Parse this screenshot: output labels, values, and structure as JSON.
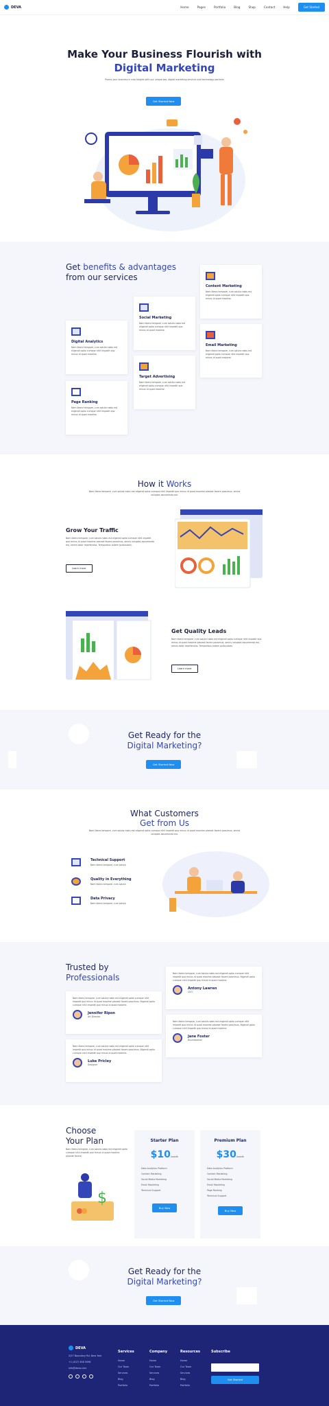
{
  "nav": {
    "brand": "DEVA",
    "items": [
      "Home",
      "Pages",
      "Portfolio",
      "Blog",
      "Shop",
      "Contact",
      "Help"
    ],
    "cta": "Get Started"
  },
  "hero": {
    "title1": "Make Your Business Flourish with",
    "title2": "Digital Marketing",
    "sub": "Promo your business in new heights with our unique seo, digital marketing services and technology partners",
    "cta": "Get Started Now"
  },
  "benefits": {
    "title1": "Get",
    "title_accent": "benefits & advantages",
    "title2": "from our services",
    "cards": [
      {
        "title": "Content Marketing",
        "text": "Nam libero tempore, cum soluta nobis est eligendi optio cumque nihil impedit quo minus id quod maxime."
      },
      {
        "title": "Social Marketing",
        "text": "Nam libero tempore, cum soluta nobis est eligendi optio cumque nihil impedit quo minus id quod maxime."
      },
      {
        "title": "Email Marketing",
        "text": "Nam libero tempore, cum soluta nobis est eligendi optio cumque nihil impedit quo minus id quod maxime."
      },
      {
        "title": "Digital Analytics",
        "text": "Nam libero tempore, cum soluta nobis est eligendi optio cumque nihil impedit quo minus id quod maxime."
      },
      {
        "title": "Target Advertising",
        "text": "Nam libero tempore, cum soluta nobis est eligendi optio cumque nihil impedit quo minus id quod maxime."
      },
      {
        "title": "Page Ranking",
        "text": "Nam libero tempore, cum soluta nobis est eligendi optio cumque nihil impedit quo minus id quod maxime."
      }
    ]
  },
  "how": {
    "title1": "How it",
    "title_accent": "Works",
    "sub": "Nam libero tempore, cum soluta nobis est eligendi optio cumque nihil impedit quo minus id quod maxime placeat facere possimus, omnis voluptas assumenda est.",
    "f1": {
      "title": "Grow Your Traffic",
      "text": "Nam libero tempore, cum soluta nobis est eligendi optio cumque nihil impedit quo minus id quod maxime placeat facere possimus, omnis voluptas assumenda est, omnis dolor repellendus. Temporibus autem quibusdam.",
      "btn": "Learn more"
    },
    "f2": {
      "title": "Get Quality Leads",
      "text": "Nam libero tempore, cum soluta nobis est eligendi optio cumque nihil impedit quo minus id quod maxime placeat facere possimus, omnis voluptas assumenda est, omnis dolor repellendus. Temporibus autem quibusdam.",
      "btn": "Learn more"
    }
  },
  "ready": {
    "line1": "Get Ready for the",
    "line2": "Digital Marketing?",
    "cta": "Get Started Now"
  },
  "customers": {
    "title1": "What Customers",
    "title2": "Get from Us",
    "sub": "Nam libero tempore, cum soluta nobis est eligendi optio cumque nihil impedit quo minus id quod maxime placeat facere possimus, omnis voluptas assumenda est.",
    "items": [
      {
        "title": "Technical Support",
        "text": "Nam libero tempore, cum soluta"
      },
      {
        "title": "Quality in Everything",
        "text": "Nam libero tempore, cum soluta"
      },
      {
        "title": "Data Privacy",
        "text": "Nam libero tempore, cum soluta"
      }
    ]
  },
  "trusted": {
    "title1": "Trusted by",
    "title2": "Professionals",
    "testimonials": [
      {
        "text": "Nam libero tempore, cum soluta nobis est eligendi optio cumque nihil impedit quo minus id quod maxime placeat facere possimus. Nigendi optio cumque nihil impedit quo minus id quod maxime.",
        "name": "Antony Lawren",
        "role": "CEO"
      },
      {
        "text": "Nam libero tempore, cum soluta nobis est eligendi optio cumque nihil impedit quo minus id quod maxime placeat facere possimus. Nigendi optio cumque nihil impedit quo minus id quod maxime.",
        "name": "Jennifer Ripon",
        "role": "Art Director"
      },
      {
        "text": "Nam libero tempore, cum soluta nobis est eligendi optio cumque nihil impedit quo minus id quod maxime placeat facere possimus. Nigendi optio cumque nihil impedit quo minus id quod maxime.",
        "name": "Jane Foster",
        "role": "Businessman"
      },
      {
        "text": "Nam libero tempore, cum soluta nobis est eligendi optio cumque nihil impedit quo minus id quod maxime placeat facere possimus. Nigendi optio cumque nihil impedit quo minus id quod maxime.",
        "name": "Luke Pricley",
        "role": "Designer"
      }
    ]
  },
  "plans": {
    "title1": "Choose",
    "title2": "Your Plan",
    "text": "Nam libero tempore, cum soluta nobis est eligendi optio cumque nihil impedit quo minus id quod maxime placeat facere.",
    "starter": {
      "name": "Starter Plan",
      "price": "$10",
      "unit": "/month",
      "features": [
        "Data Analytics Platform",
        "Content Marketing",
        "Social Media Marketing",
        "Email Marketing",
        "Technical Support"
      ],
      "btn": "Buy Now"
    },
    "premium": {
      "name": "Premium Plan",
      "price": "$30",
      "unit": "/month",
      "features": [
        "Data Analytics Platform",
        "Content Marketing",
        "Social Media Marketing",
        "Email Marketing",
        "Page Ranking",
        "Technical Support"
      ],
      "btn": "Buy Now"
    }
  },
  "footer": {
    "brand": "DEVA",
    "address": "2/27 Boundary Rd, New York",
    "phone": "+1 (437) 458 5596",
    "email": "info@deva.com",
    "services": {
      "title": "Services",
      "items": [
        "Home",
        "Our Team",
        "Services",
        "Blog",
        "Portfolio"
      ]
    },
    "company": {
      "title": "Company",
      "items": [
        "Home",
        "Our Team",
        "Services",
        "Blog",
        "Portfolio"
      ]
    },
    "resources": {
      "title": "Resources",
      "items": [
        "Home",
        "Our Team",
        "Services",
        "Blog",
        "Portfolio"
      ]
    },
    "subscribe": {
      "title": "Subscribe",
      "placeholder": "",
      "btn": "Get Started"
    }
  },
  "colors": {
    "accent": "#1e8ef0",
    "navy": "#1e2577",
    "heading": "#1c2560"
  }
}
